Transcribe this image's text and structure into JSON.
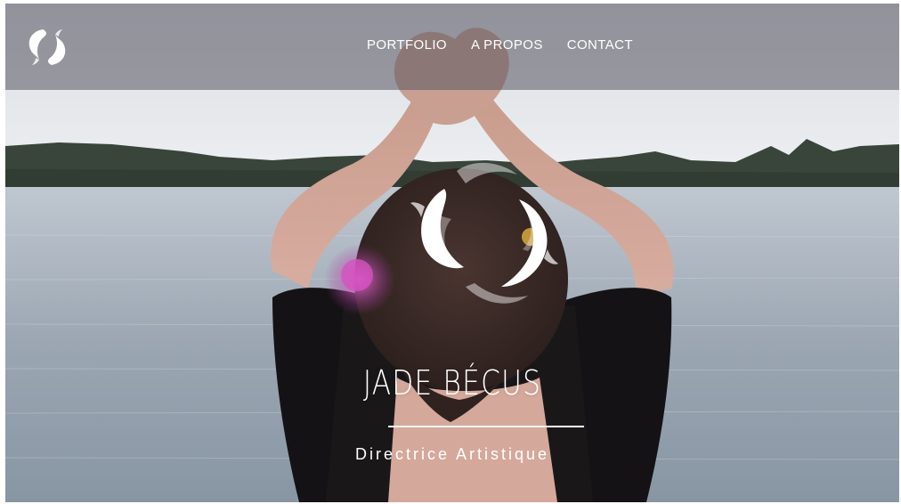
{
  "nav": {
    "logo_icon": "koi-fish-logo-icon",
    "items": [
      {
        "label": "PORTFOLIO"
      },
      {
        "label": "A PROPOS"
      },
      {
        "label": "CONTACT"
      }
    ]
  },
  "hero": {
    "title": "JADE BÉCUS",
    "subtitle": "Directrice Artistique",
    "logo_icon": "koi-fish-emblem-icon",
    "photo": "woman-with-raised-arms-by-lake"
  },
  "colors": {
    "nav_overlay": "#585660",
    "text": "#ffffff",
    "lake": "#9aa6b3",
    "sky": "#e9ebee"
  }
}
